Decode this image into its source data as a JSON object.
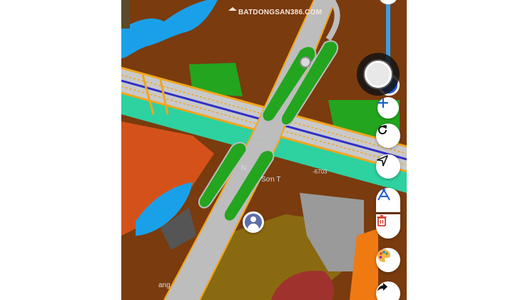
{
  "watermark": {
    "text": "BATDONGSAN386.COM"
  },
  "map": {
    "labels": {
      "road_code": "-6703",
      "place_partial": "N",
      "place_partial_2": "Sơn T",
      "place_partial_3": "ang"
    }
  },
  "controls": {
    "zoom_in_icon": "plus-icon",
    "refresh_icon": "refresh-icon",
    "locate_icon": "navigation-arrow-icon",
    "measure_icon": "measure-tool-icon",
    "delete_icon": "trash-icon",
    "palette_icon": "palette-icon",
    "share_icon": "share-icon"
  },
  "colors": {
    "zoning_brown": "#7a3b0e",
    "water_blue": "#1aa0e8",
    "green_space": "#23a51f",
    "teal_band": "#2ed1a0",
    "orange_zone": "#d4521a",
    "olive_zone": "#8a6a10",
    "road_outline": "#f2a51c",
    "road_center": "#3030c8",
    "accent_blue": "#1e5bd6",
    "delete_red": "#d23c2c"
  }
}
